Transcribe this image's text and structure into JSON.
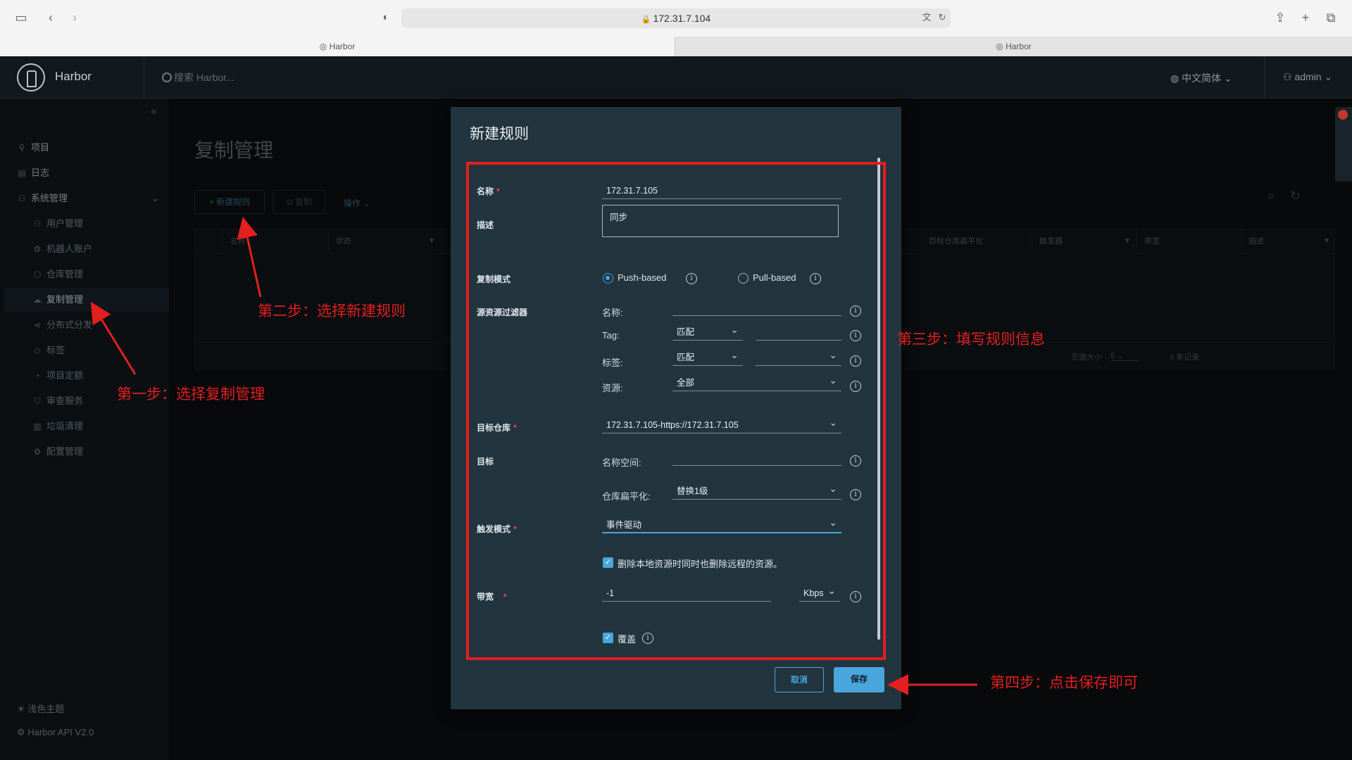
{
  "browser": {
    "url": "172.31.7.104",
    "tabs": [
      "Harbor",
      "Harbor"
    ]
  },
  "header": {
    "brand": "Harbor",
    "search_placeholder": "搜索 Harbor...",
    "language": "中文简体",
    "user": "admin"
  },
  "sidebar": {
    "items": [
      {
        "label": "项目",
        "icon": "project-icon"
      },
      {
        "label": "日志",
        "icon": "log-icon"
      },
      {
        "label": "系统管理",
        "icon": "admin-icon"
      }
    ],
    "sub_items": [
      {
        "label": "用户管理",
        "icon": "users-icon"
      },
      {
        "label": "机器人账户",
        "icon": "robot-icon"
      },
      {
        "label": "仓库管理",
        "icon": "registry-icon"
      },
      {
        "label": "复制管理",
        "icon": "replication-icon",
        "active": true
      },
      {
        "label": "分布式分发",
        "icon": "distribution-icon"
      },
      {
        "label": "标签",
        "icon": "label-icon"
      },
      {
        "label": "项目定额",
        "icon": "quota-icon"
      },
      {
        "label": "审查服务",
        "icon": "scanner-icon"
      },
      {
        "label": "垃圾清理",
        "icon": "trash-icon"
      },
      {
        "label": "配置管理",
        "icon": "config-icon"
      }
    ],
    "theme": "浅色主题",
    "api": "Harbor API V2.0"
  },
  "main": {
    "title": "复制管理",
    "new_rule_button": "+ 新建规则",
    "copy_button": "复制",
    "ops_menu": "操作",
    "columns": [
      "名称",
      "状态",
      "目标仓库扁平化",
      "触发器",
      "带宽",
      "描述"
    ],
    "page_size_label": "页面大小",
    "page_size": "5",
    "record_count": "0 条记录"
  },
  "modal": {
    "title": "新建规则",
    "name_label": "名称",
    "name_value": "172.31.7.105",
    "desc_label": "描述",
    "desc_value": "同步",
    "mode_label": "复制模式",
    "push_label": "Push-based",
    "pull_label": "Pull-based",
    "filter_label": "源资源过滤器",
    "filter_name_label": "名称:",
    "filter_tag_label": "Tag:",
    "filter_tag_match": "匹配",
    "filter_label_label": "标签:",
    "filter_label_match": "匹配",
    "filter_res_label": "资源:",
    "filter_res_value": "全部",
    "target_repo_label": "目标仓库",
    "target_repo_value": "172.31.7.105-https://172.31.7.105",
    "target_label": "目标",
    "namespace_label": "名称空间:",
    "flatten_label": "仓库扁平化:",
    "flatten_value": "替换1级",
    "trigger_label": "触发模式",
    "trigger_value": "事件驱动",
    "delete_remote_text": "删除本地资源时同时也删除远程的资源。",
    "bandwidth_label": "带宽",
    "bandwidth_value": "-1",
    "bandwidth_unit": "Kbps",
    "override_label": "覆盖",
    "cancel_button": "取消",
    "save_button": "保存"
  },
  "annotations": {
    "step1": "第一步：选择复制管理",
    "step2": "第二步：选择新建规则",
    "step3": "第三步：填写规则信息",
    "step4": "第四步：点击保存即可"
  },
  "colors": {
    "accent": "#49a6dd",
    "annotation_red": "#e31f1f",
    "modal_bg": "#22343d",
    "page_bg": "#0b0f12"
  }
}
